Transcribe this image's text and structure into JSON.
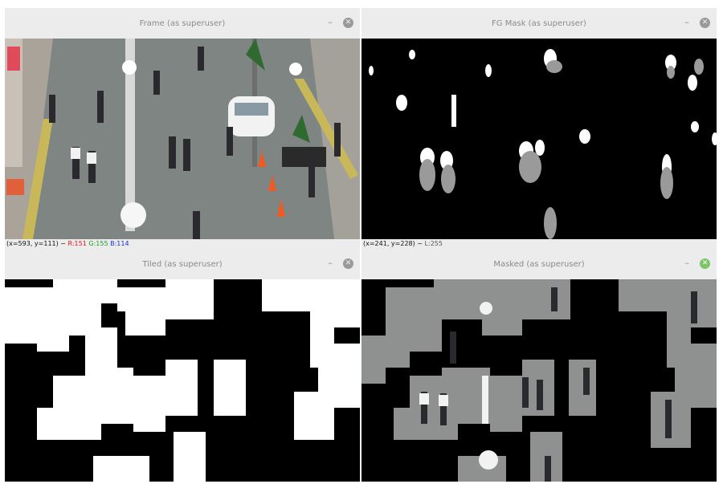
{
  "windows": {
    "frame": {
      "title": "Frame (as superuser)",
      "status": {
        "coords": "(x=593, y=111) ~",
        "r": "R:151",
        "g": "G:155",
        "b": "B:114"
      }
    },
    "fgmask": {
      "title": "FG Mask (as superuser)",
      "status": {
        "coords": "(x=241, y=228) ~",
        "l": "L:255"
      }
    },
    "tiled": {
      "title": "Tiled (as superuser)"
    },
    "masked": {
      "title": "Masked (as superuser)"
    }
  },
  "controls": {
    "minimize": "–",
    "close": "✕"
  },
  "icons": {
    "minimize": "minimize-icon",
    "close": "close-icon"
  },
  "colors": {
    "titlebar_bg": "#ececec",
    "title_text": "#8a8a8a",
    "active_close": "#7cc46a",
    "red": "#e0141f",
    "green": "#1a9b26",
    "blue": "#1c2ee0"
  }
}
